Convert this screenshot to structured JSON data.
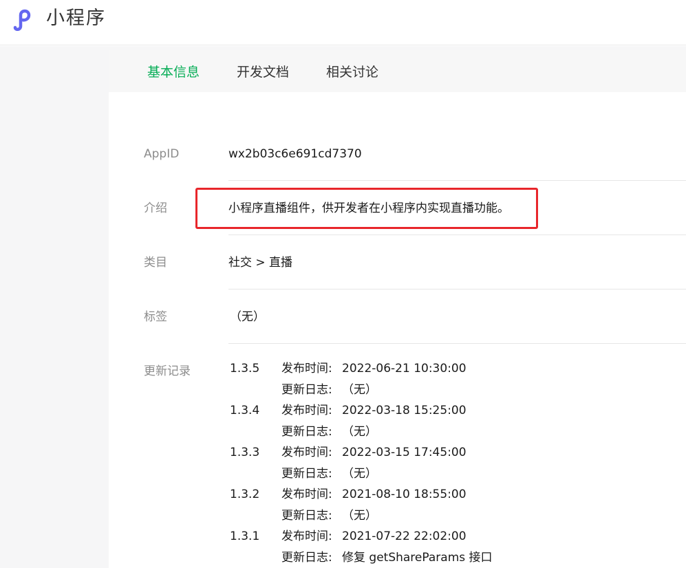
{
  "header": {
    "app_title": "小程序",
    "logo_icon": "mini-program-logo-icon",
    "accent_color": "#6467f0"
  },
  "tabs": [
    {
      "label": "基本信息",
      "active": true
    },
    {
      "label": "开发文档",
      "active": false
    },
    {
      "label": "相关讨论",
      "active": false
    }
  ],
  "info": {
    "appid_label": "AppID",
    "appid_value": "wx2b03c6e691cd7370",
    "intro_label": "介绍",
    "intro_value": "小程序直播组件，供开发者在小程序内实现直播功能。",
    "category_label": "类目",
    "category_value": "社交 > 直播",
    "tags_label": "标签",
    "tags_value": "（无）",
    "changelog_label": "更新记录"
  },
  "changelog": [
    {
      "version": "1.3.5",
      "publish_key": "发布时间:",
      "publish_time": "2022-06-21 10:30:00",
      "log_key": "更新日志:",
      "log_value": "（无）"
    },
    {
      "version": "1.3.4",
      "publish_key": "发布时间:",
      "publish_time": "2022-03-18 15:25:00",
      "log_key": "更新日志:",
      "log_value": "（无）"
    },
    {
      "version": "1.3.3",
      "publish_key": "发布时间:",
      "publish_time": "2022-03-15 17:45:00",
      "log_key": "更新日志:",
      "log_value": "（无）"
    },
    {
      "version": "1.3.2",
      "publish_key": "发布时间:",
      "publish_time": "2021-08-10 18:55:00",
      "log_key": "更新日志:",
      "log_value": "（无）"
    },
    {
      "version": "1.3.1",
      "publish_key": "发布时间:",
      "publish_time": "2021-07-22 22:02:00",
      "log_key": "更新日志:",
      "log_value": "修复 getShareParams 接口"
    }
  ],
  "colors": {
    "active_tab": "#06ad56",
    "highlight_border": "#e8262b"
  }
}
